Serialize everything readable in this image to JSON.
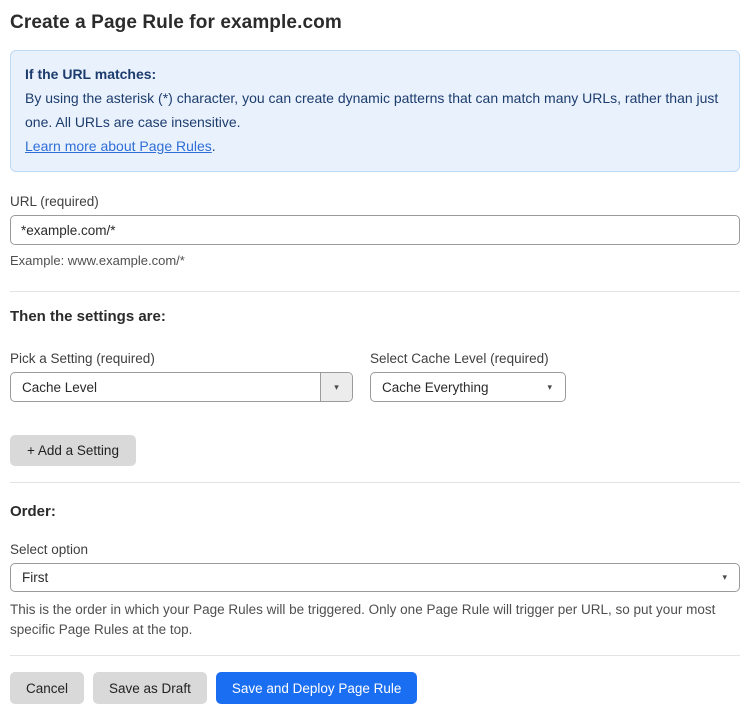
{
  "page": {
    "title": "Create a Page Rule for example.com"
  },
  "info_box": {
    "heading": "If the URL matches:",
    "body": "By using the asterisk (*) character, you can create dynamic patterns that can match many URLs, rather than just one. All URLs are case insensitive.",
    "link_label": "Learn more about Page Rules",
    "link_suffix": "."
  },
  "url_field": {
    "label": "URL (required)",
    "value": "*example.com/*",
    "hint": "Example: www.example.com/*"
  },
  "settings_section": {
    "heading": "Then the settings are:",
    "setting_select": {
      "label": "Pick a Setting (required)",
      "value": "Cache Level"
    },
    "cache_level_select": {
      "label": "Select Cache Level (required)",
      "value": "Cache Everything"
    },
    "add_setting_label": "+ Add a Setting"
  },
  "order_section": {
    "heading": "Order:",
    "select_label": "Select option",
    "selected_value": "First",
    "hint": "This is the order in which your Page Rules will be triggered. Only one Page Rule will trigger per URL, so put your most specific Page Rules at the top."
  },
  "actions": {
    "cancel_label": "Cancel",
    "save_draft_label": "Save as Draft",
    "save_deploy_label": "Save and Deploy Page Rule"
  },
  "icons": {
    "caret_down": "▾"
  },
  "colors": {
    "accent_blue": "#1a6ef2",
    "info_bg": "#e9f2fc",
    "info_border": "#bed9f4",
    "info_text": "#1d3c6e",
    "link_blue": "#2f6ed6",
    "gray_button_bg": "#d9d9d9",
    "border_gray": "#9b9b9b",
    "divider_gray": "#e3e3e3"
  }
}
